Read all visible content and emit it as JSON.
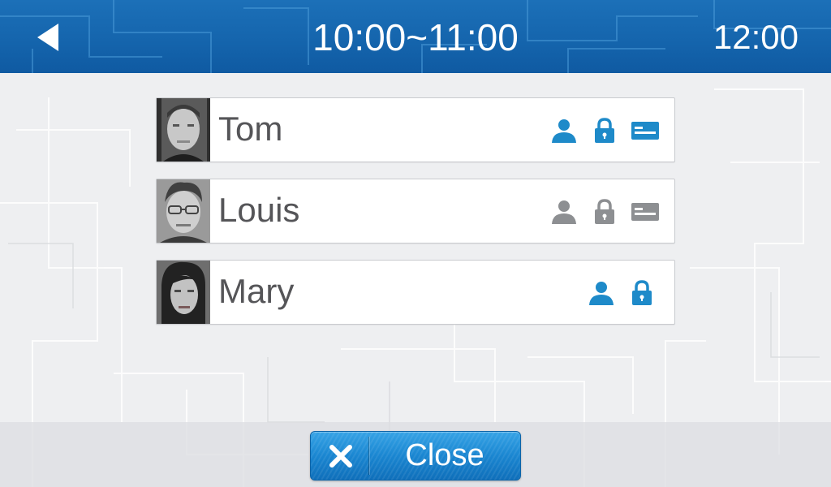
{
  "header": {
    "time_range": "10:00~11:00",
    "clock": "12:00",
    "back_icon": "back-arrow-icon"
  },
  "users": [
    {
      "name": "Tom",
      "icons": [
        "person-icon",
        "lock-icon",
        "card-icon"
      ],
      "status": "active"
    },
    {
      "name": "Louis",
      "icons": [
        "person-icon",
        "lock-icon",
        "card-icon"
      ],
      "status": "inactive"
    },
    {
      "name": "Mary",
      "icons": [
        "person-icon",
        "lock-icon"
      ],
      "status": "active"
    }
  ],
  "footer": {
    "close_label": "Close",
    "close_icon": "close-x-icon"
  },
  "colors": {
    "header": "#1565ad",
    "icon_active": "#1e8ac9",
    "icon_inactive": "#8d8f92",
    "button": "#1a86d1"
  }
}
